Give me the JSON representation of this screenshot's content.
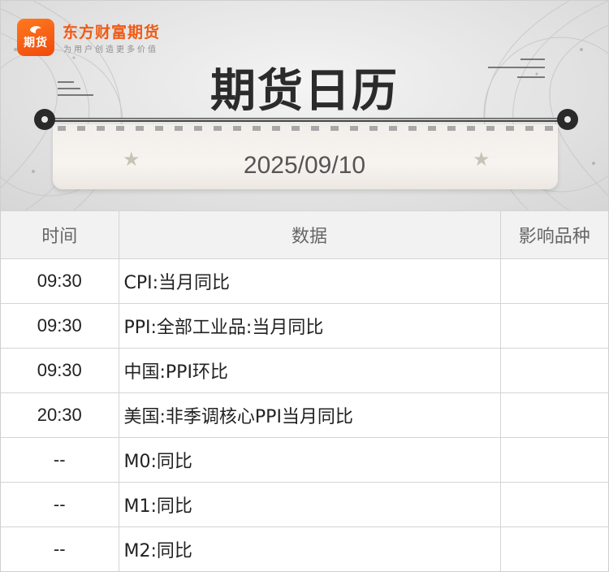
{
  "brand": {
    "logo_text": "期货",
    "name": "东方财富期货",
    "slogan": "为用户创造更多价值"
  },
  "title": "期货日历",
  "date": "2025/09/10",
  "table": {
    "headers": [
      "时间",
      "数据",
      "影响品种"
    ],
    "rows": [
      {
        "time": "09:30",
        "data": "CPI:当月同比",
        "affected": ""
      },
      {
        "time": "09:30",
        "data": "PPI:全部工业品:当月同比",
        "affected": ""
      },
      {
        "time": "09:30",
        "data": "中国:PPI环比",
        "affected": ""
      },
      {
        "time": "20:30",
        "data": "美国:非季调核心PPI当月同比",
        "affected": ""
      },
      {
        "time": "--",
        "data": "M0:同比",
        "affected": ""
      },
      {
        "time": "--",
        "data": "M1:同比",
        "affected": ""
      },
      {
        "time": "--",
        "data": "M2:同比",
        "affected": ""
      }
    ]
  },
  "colors": {
    "brand_orange": "#f05a14",
    "title": "#2b2b2b",
    "header_bg": "#f2f2f2"
  }
}
